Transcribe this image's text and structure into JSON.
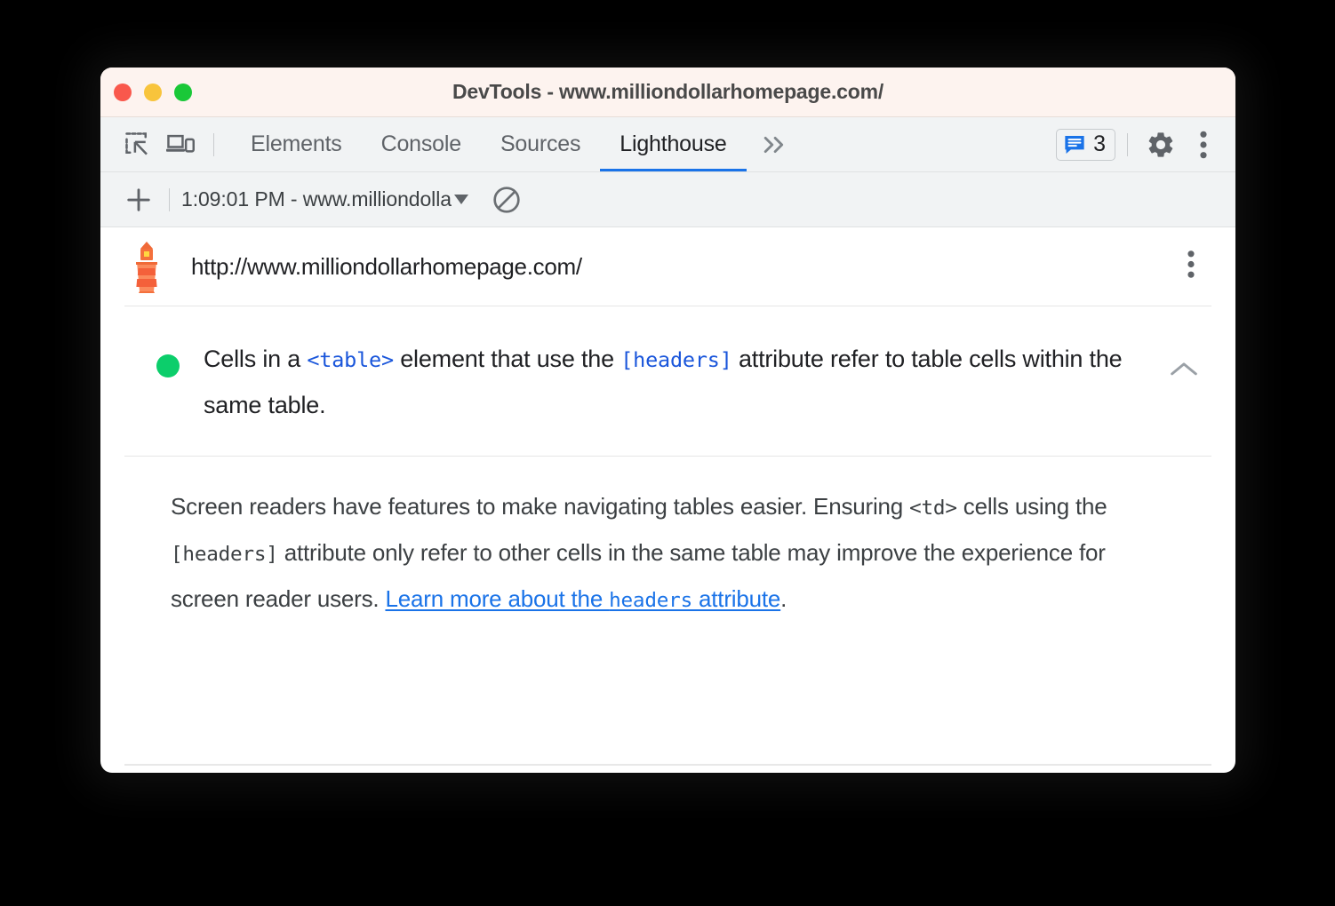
{
  "window": {
    "title": "DevTools - www.milliondollarhomepage.com/",
    "traffic_lights": [
      {
        "name": "close",
        "color": "#f9584c"
      },
      {
        "name": "minimize",
        "color": "#f8c43c"
      },
      {
        "name": "maximize",
        "color": "#1ac838"
      }
    ]
  },
  "toolbar": {
    "inspect_icon": "inspect-element-icon",
    "device_icon": "device-toolbar-icon",
    "tabs": [
      {
        "label": "Elements",
        "active": false
      },
      {
        "label": "Console",
        "active": false
      },
      {
        "label": "Sources",
        "active": false
      },
      {
        "label": "Lighthouse",
        "active": true
      }
    ],
    "more_tabs_label": "»",
    "messages": {
      "icon": "message-icon",
      "count": "3"
    },
    "settings_icon": "gear-icon",
    "menu_icon": "kebab-menu-icon",
    "accent_color": "#1a73e8"
  },
  "subbar": {
    "new_report_label": "+",
    "run_selector_value": "1:09:01 PM - www.milliondolla",
    "run_selector_caret": "chevron-down-icon",
    "clear_label": "clear-results-icon"
  },
  "report": {
    "logo": "lighthouse-logo",
    "url": "http://www.milliondollarhomepage.com/",
    "menu_icon": "kebab-menu-icon"
  },
  "audit": {
    "score_color": "#0cce6b",
    "score_state": "pass",
    "collapse_icon": "chevron-up-icon",
    "title": {
      "part1": "Cells in a ",
      "code1": "<table>",
      "part2": " element that use the ",
      "code2": "[headers]",
      "part3": " attribute refer to table cells within the same table."
    },
    "description": {
      "part1": "Screen readers have features to make navigating tables easier. Ensuring ",
      "code1": "<td>",
      "part2": " cells using the ",
      "code2": "[headers]",
      "part3": " attribute only refer to other cells in the same table may improve the experience for screen reader users. ",
      "link_text1": "Learn more about the ",
      "link_code": "headers",
      "link_text2": " attribute",
      "part4": "."
    }
  }
}
